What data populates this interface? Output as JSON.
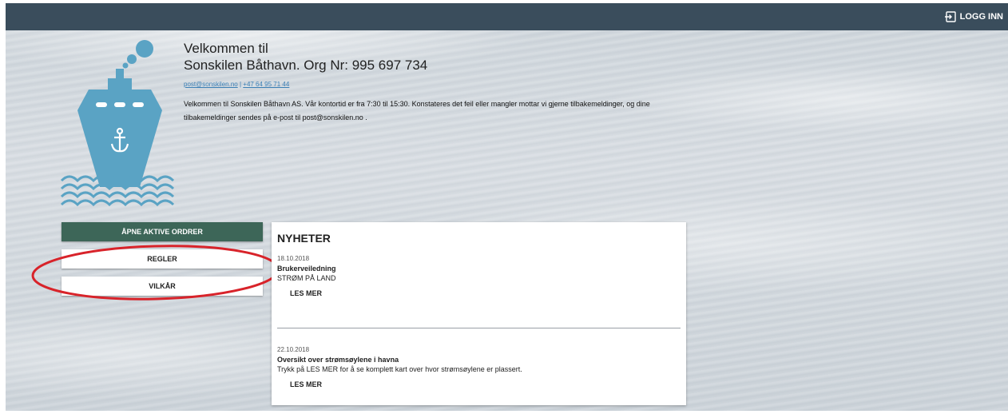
{
  "header": {
    "login_label": "LOGG INN",
    "login_icon": "login-icon",
    "background_color": "#3a4d5c"
  },
  "branding": {
    "logo_icon": "ship-anchor-logo",
    "logo_color": "#5aa3c4"
  },
  "welcome": {
    "line1": "Velkommen til",
    "line2": "Sonskilen Båthavn. Org Nr: 995 697 734",
    "email": "post@sonskilen.no",
    "separator": "|",
    "phone": "+47 64 95 71 44",
    "intro": "Velkommen til Sonskilen Båthavn AS. Vår kontortid er fra 7:30 til 15:30. Konstateres det feil eller mangler mottar vi gjerne tilbakemeldinger, og dine tilbakemeldinger sendes på e-post til post@sonskilen.no ."
  },
  "sidebar": {
    "open_orders_label": "ÅPNE AKTIVE ORDRER",
    "rules_label": "REGLER",
    "terms_label": "VILKÅR",
    "primary_color": "#3d6658"
  },
  "annotation": {
    "color": "#d8232a"
  },
  "news": {
    "title": "NYHETER",
    "items": [
      {
        "date": "18.10.2018",
        "headline": "Brukerveiledning",
        "text": "STRØM PÅ LAND",
        "more_label": "LES MER"
      },
      {
        "date": "22.10.2018",
        "headline": "Oversikt over strømsøylene i havna",
        "text": "Trykk på LES MER for å se komplett kart over hvor strømsøylene er plassert.",
        "more_label": "LES MER"
      }
    ]
  }
}
